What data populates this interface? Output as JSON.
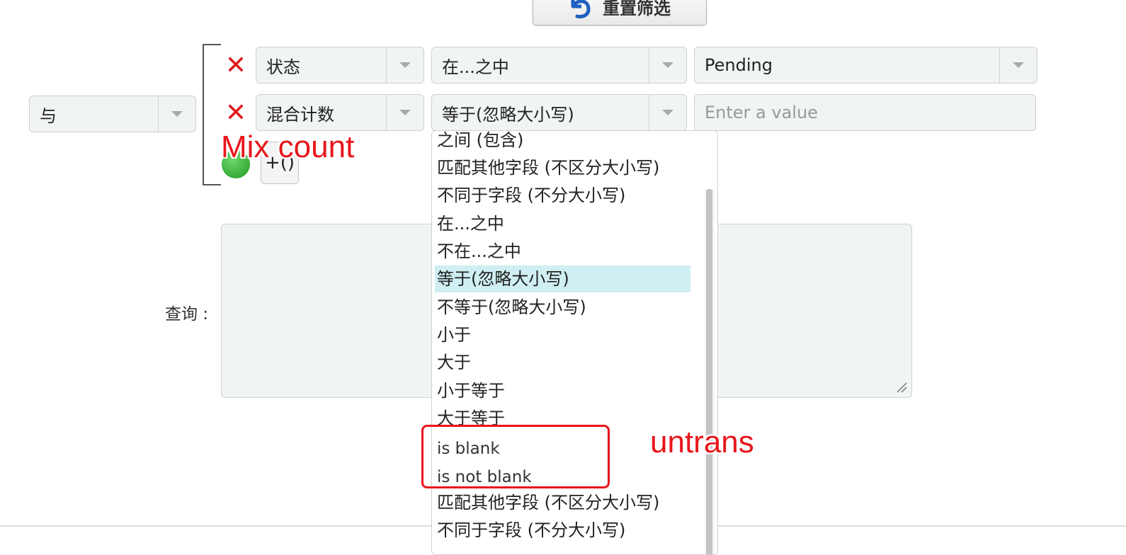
{
  "toolbar": {
    "reset_label": "重置筛选"
  },
  "filters": {
    "group_operator": "与",
    "rows": [
      {
        "field": "状态",
        "operator": "在...之中",
        "value": "Pending"
      },
      {
        "field": "混合计数",
        "operator": "等于(忽略大小写)",
        "value": "",
        "value_placeholder": "Enter a value"
      }
    ],
    "counter_label": "+()"
  },
  "query": {
    "label": "查询 :"
  },
  "operator_dropdown": {
    "options": [
      "之间 (包含)",
      "匹配其他字段 (不区分大小写)",
      "不同于字段 (不分大小写)",
      "在...之中",
      "不在...之中",
      "等于(忽略大小写)",
      "不等于(忽略大小写)",
      "小于",
      "大于",
      "小于等于",
      "大于等于",
      "is blank",
      "is not blank",
      "匹配其他字段 (不区分大小写)",
      "不同于字段 (不分大小写)"
    ],
    "selected_index": 5
  },
  "annotations": {
    "mix_count": "Mix count",
    "untrans": "untrans"
  },
  "colors": {
    "remove_icon": "#e01b1b",
    "annotation": "#e8161b",
    "highlight": "#cfeff2",
    "add_icon": "#1f9a1f"
  }
}
